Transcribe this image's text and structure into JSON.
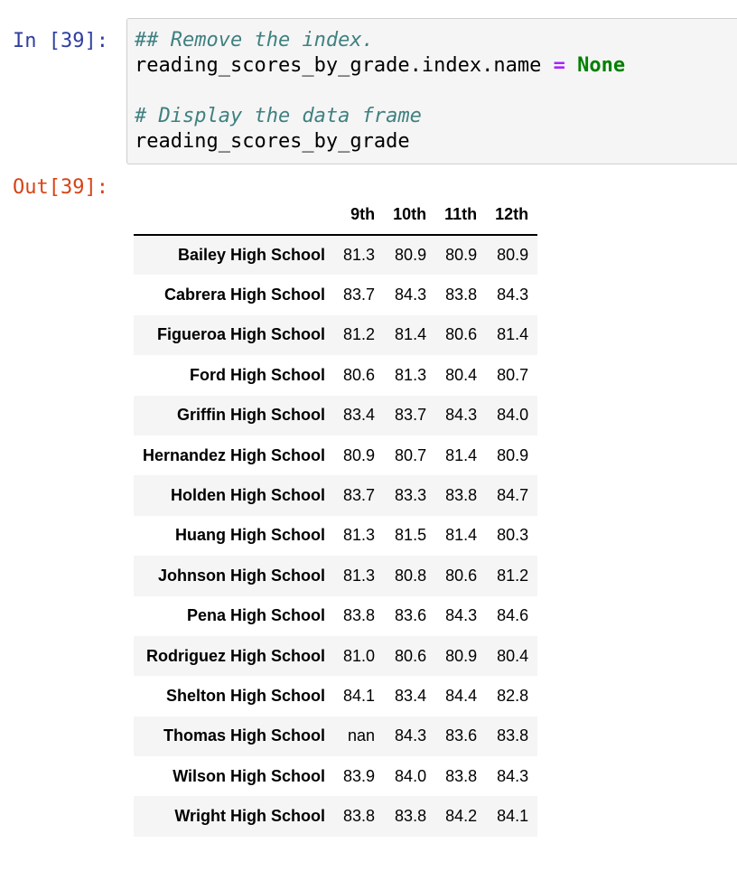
{
  "input_prompt": "In [39]:",
  "output_prompt": "Out[39]:",
  "code": {
    "line1_comment": "## Remove the index.",
    "line2_target": "reading_scores_by_grade.index.name ",
    "line2_operator": "=",
    "line2_keyword": "None",
    "line4_comment": "# Display the data frame",
    "line5": "reading_scores_by_grade"
  },
  "table": {
    "index_header": "",
    "columns": [
      "9th",
      "10th",
      "11th",
      "12th"
    ],
    "rows": [
      {
        "school": "Bailey High School",
        "values": [
          "81.3",
          "80.9",
          "80.9",
          "80.9"
        ]
      },
      {
        "school": "Cabrera High School",
        "values": [
          "83.7",
          "84.3",
          "83.8",
          "84.3"
        ]
      },
      {
        "school": "Figueroa High School",
        "values": [
          "81.2",
          "81.4",
          "80.6",
          "81.4"
        ]
      },
      {
        "school": "Ford High School",
        "values": [
          "80.6",
          "81.3",
          "80.4",
          "80.7"
        ]
      },
      {
        "school": "Griffin High School",
        "values": [
          "83.4",
          "83.7",
          "84.3",
          "84.0"
        ]
      },
      {
        "school": "Hernandez High School",
        "values": [
          "80.9",
          "80.7",
          "81.4",
          "80.9"
        ]
      },
      {
        "school": "Holden High School",
        "values": [
          "83.7",
          "83.3",
          "83.8",
          "84.7"
        ]
      },
      {
        "school": "Huang High School",
        "values": [
          "81.3",
          "81.5",
          "81.4",
          "80.3"
        ]
      },
      {
        "school": "Johnson High School",
        "values": [
          "81.3",
          "80.8",
          "80.6",
          "81.2"
        ]
      },
      {
        "school": "Pena High School",
        "values": [
          "83.8",
          "83.6",
          "84.3",
          "84.6"
        ]
      },
      {
        "school": "Rodriguez High School",
        "values": [
          "81.0",
          "80.6",
          "80.9",
          "80.4"
        ]
      },
      {
        "school": "Shelton High School",
        "values": [
          "84.1",
          "83.4",
          "84.4",
          "82.8"
        ]
      },
      {
        "school": "Thomas High School",
        "values": [
          "nan",
          "84.3",
          "83.6",
          "83.8"
        ]
      },
      {
        "school": "Wilson High School",
        "values": [
          "83.9",
          "84.0",
          "83.8",
          "84.3"
        ]
      },
      {
        "school": "Wright High School",
        "values": [
          "83.8",
          "83.8",
          "84.2",
          "84.1"
        ]
      }
    ]
  },
  "colors": {
    "input_prompt": "#303f9f",
    "output_prompt": "#d84315",
    "comment": "#408080",
    "operator": "#aa22ff",
    "keyword": "#008000",
    "stripe": "#f5f5f5"
  }
}
